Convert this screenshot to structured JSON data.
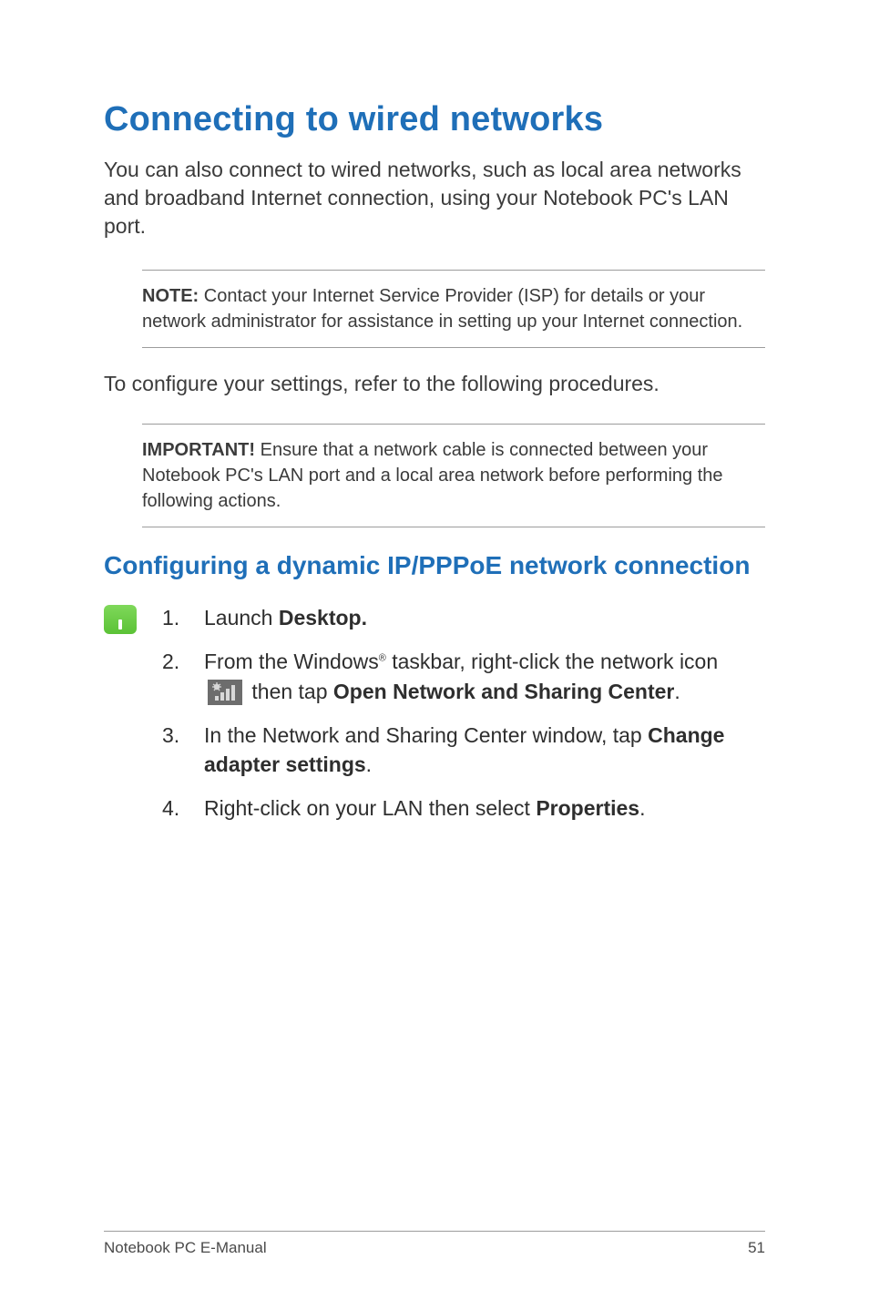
{
  "title": "Connecting to wired networks",
  "intro": "You can also connect to wired networks, such as local area networks and broadband Internet connection, using your Notebook PC's LAN port.",
  "note": {
    "label": "NOTE:",
    "text": " Contact your Internet Service Provider (ISP) for details or your network administrator for assistance in setting up your Internet connection."
  },
  "mid": "To configure your settings, refer to the following procedures.",
  "important": {
    "label": "IMPORTANT!",
    "text": "  Ensure that a network cable is connected between your Notebook PC's LAN port and a local area network before performing the following actions."
  },
  "subheading": "Configuring a dynamic IP/PPPoE network connection",
  "steps": {
    "s1_a": "Launch ",
    "s1_b": "Desktop.",
    "s2_a": "From the Windows",
    "s2_sup": "®",
    "s2_b": " taskbar, right-click the network icon ",
    "s2_c": " then tap ",
    "s2_d": "Open Network and Sharing Center",
    "s2_e": ".",
    "s3_a": "In the Network and Sharing Center window, tap ",
    "s3_b": "Change adapter settings",
    "s3_c": ".",
    "s4_a": "Right-click on your LAN then select ",
    "s4_b": "Properties",
    "s4_c": "."
  },
  "footer": {
    "left": "Notebook PC E-Manual",
    "right": "51"
  }
}
